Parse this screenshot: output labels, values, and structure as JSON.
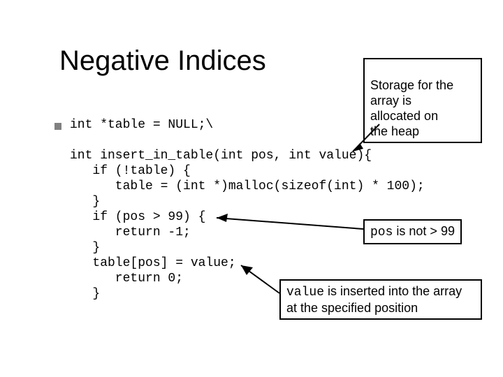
{
  "title": "Negative Indices",
  "code": "int *table = NULL;\\\n\nint insert_in_table(int pos, int value){\n   if (!table) {\n      table = (int *)malloc(sizeof(int) * 100);\n   }\n   if (pos > 99) {\n      return -1;\n   }\n   table[pos] = value;\n      return 0;\n   }",
  "callouts": {
    "heap": "Storage for the\narray is\nallocated on\nthe heap",
    "pos_prefix": "pos",
    "pos_rest": " is not > 99",
    "value_prefix": "value",
    "value_rest": " is inserted into the\narray at the specified position"
  }
}
